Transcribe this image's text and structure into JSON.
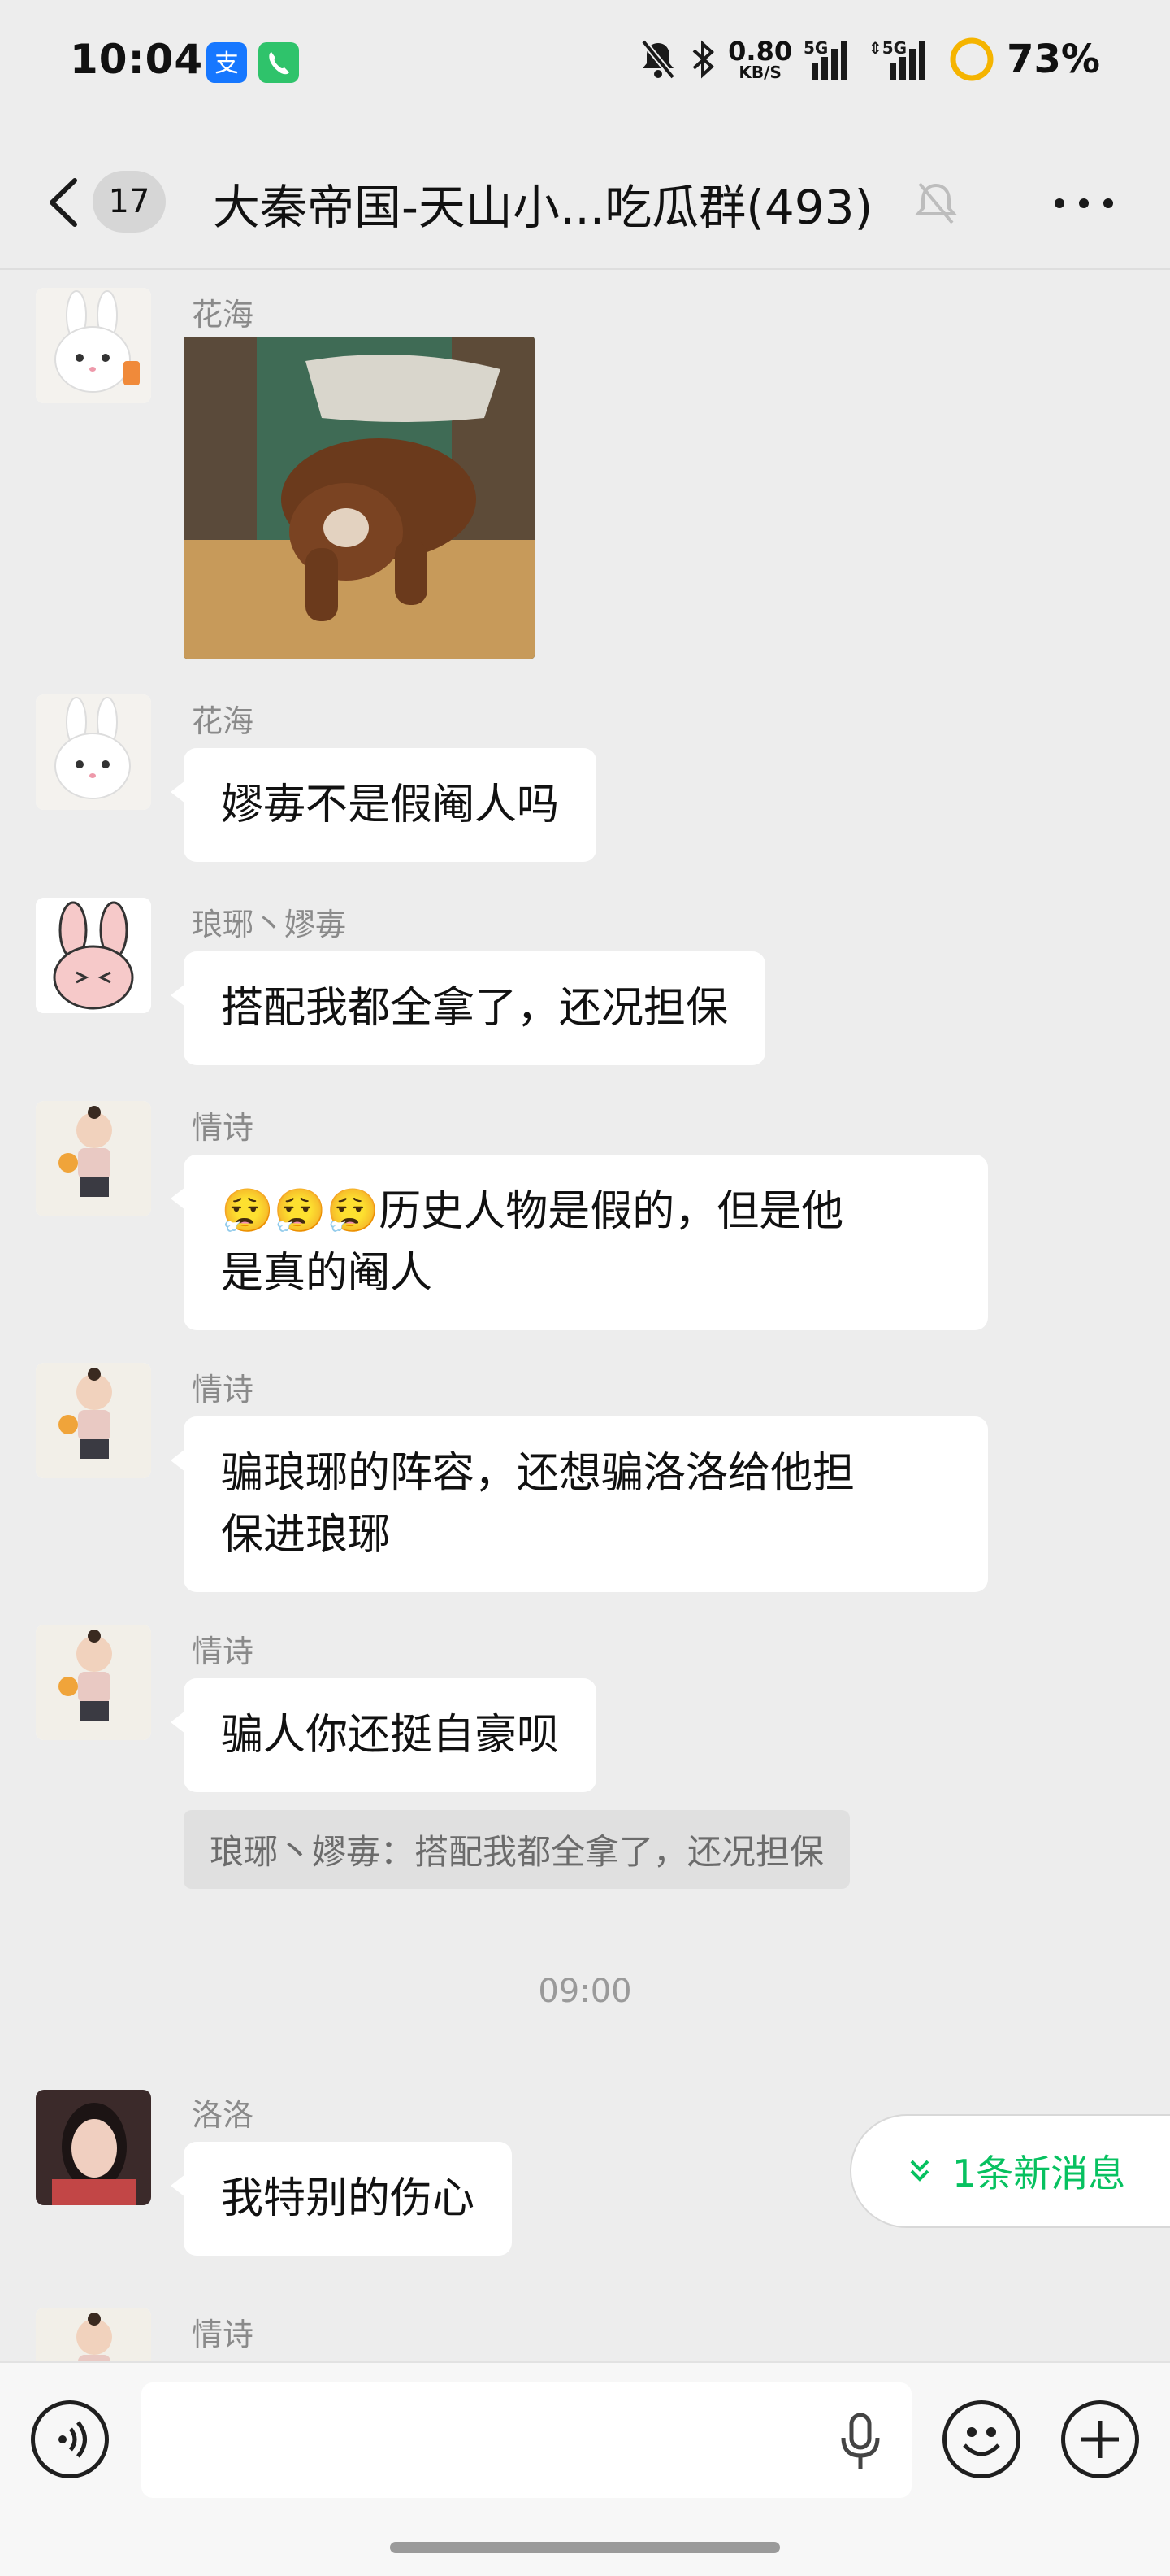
{
  "status_bar": {
    "time": "10:04",
    "net_speed_value": "0.80",
    "net_speed_unit": "KB/S",
    "battery": "73%",
    "icons": [
      "alipay-icon",
      "phone-icon",
      "mute-bell-icon",
      "bluetooth-icon",
      "signal-5g-icon",
      "signal-5g-icon",
      "battery-icon"
    ]
  },
  "header": {
    "unread_count": "17",
    "title": "大秦帝国-天山小...吃瓜群(493)"
  },
  "messages": [
    {
      "sender": "花海",
      "type": "image",
      "image_desc": "bear-sticker"
    },
    {
      "sender": "花海",
      "text": "嫪毐不是假阉人吗"
    },
    {
      "sender": "琅琊丶嫪毐",
      "text": "搭配我都全拿了，还况担保"
    },
    {
      "sender": "情诗",
      "text_line1": "😮‍💨😮‍💨😮‍💨历史人物是假的，但是他",
      "text_line2": "是真的阉人"
    },
    {
      "sender": "情诗",
      "text_line1": "骗琅琊的阵容，还想骗洛洛给他担",
      "text_line2": "保进琅琊"
    },
    {
      "sender": "情诗",
      "text": "骗人你还挺自豪呗",
      "quote": "琅琊丶嫪毐：搭配我都全拿了，还况担保"
    },
    {
      "sender": "洛洛",
      "text": "我特别的伤心"
    },
    {
      "sender": "情诗"
    }
  ],
  "timestamp": "09:00",
  "new_message_pill": "1条新消息",
  "colors": {
    "accent": "#07c160",
    "background": "#ededed",
    "bubble": "#ffffff"
  }
}
